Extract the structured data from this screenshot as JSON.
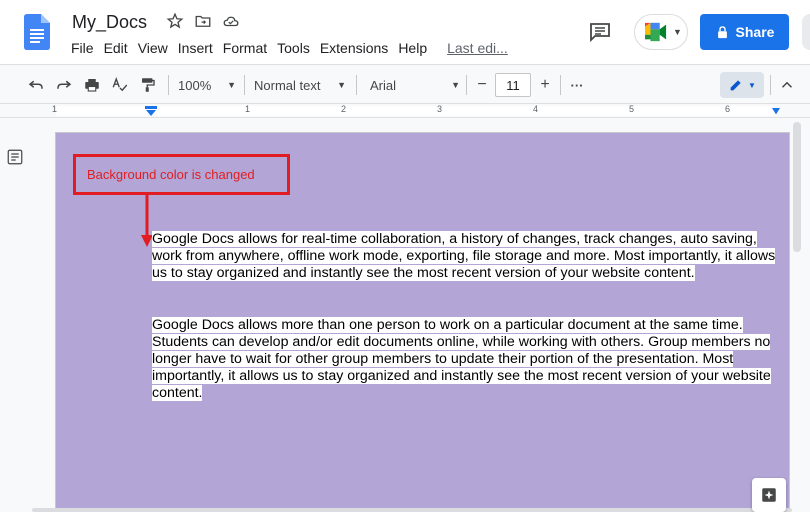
{
  "header": {
    "title": "My_Docs",
    "share_label": "Share",
    "menu": [
      "File",
      "Edit",
      "View",
      "Insert",
      "Format",
      "Tools",
      "Extensions",
      "Help"
    ],
    "last_edit": "Last edi..."
  },
  "toolbar": {
    "zoom": "100%",
    "style": "Normal text",
    "font": "Arial",
    "font_size": "11",
    "minus": "−",
    "plus": "+",
    "more": "···"
  },
  "ruler": {
    "numbers": [
      "1",
      "1",
      "2",
      "3",
      "4",
      "5",
      "6",
      "7"
    ]
  },
  "annotation": {
    "label": "Background color is changed"
  },
  "document": {
    "paragraphs": [
      "Google Docs allows for real-time collaboration, a history of changes, track changes, auto saving, work from anywhere, offline work mode, exporting, file storage and more. Most importantly, it allows us to stay organized and instantly see the most recent version of your website content.",
      "Google Docs allows more than one person to work on a particular document at the same time. Students can develop and/or edit documents online, while working with others. Group members no longer have to wait for other group members to update their portion of the presentation. Most importantly, it allows us to stay organized and instantly see the most recent version of your website content."
    ],
    "page_background": "#b3a6d6"
  },
  "colors": {
    "accent": "#1a73e8",
    "annotation": "#e11c22"
  }
}
